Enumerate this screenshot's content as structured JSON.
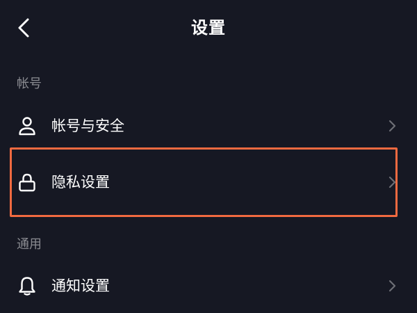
{
  "header": {
    "title": "设置",
    "back_icon": "chevron-left-icon"
  },
  "sections": [
    {
      "title": "帐号",
      "items": [
        {
          "label": "帐号与安全",
          "icon": "user-icon"
        },
        {
          "label": "隐私设置",
          "icon": "lock-icon",
          "highlighted": true
        }
      ]
    },
    {
      "title": "通用",
      "items": [
        {
          "label": "通知设置",
          "icon": "bell-icon"
        }
      ]
    }
  ],
  "colors": {
    "background": "#161823",
    "text": "#ffffff",
    "section_header": "#8a8b91",
    "chevron": "#6e6f76",
    "highlight": "#f26a40"
  }
}
